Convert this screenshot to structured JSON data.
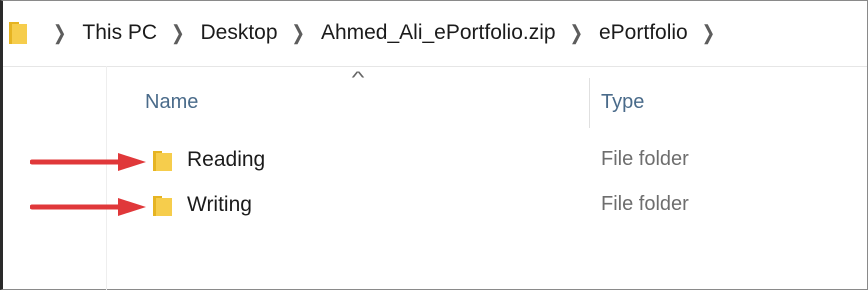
{
  "addressbar": {
    "breadcrumbs": [
      "This PC",
      "Desktop",
      "Ahmed_Ali_ePortfolio.zip",
      "ePortfolio"
    ]
  },
  "columns": {
    "name": "Name",
    "type": "Type"
  },
  "rows": [
    {
      "name": "Reading",
      "type": "File folder",
      "highlighted_by_arrow": true
    },
    {
      "name": "Writing",
      "type": "File folder",
      "highlighted_by_arrow": true
    }
  ],
  "icons": {
    "folder": "folder-icon",
    "chevron": "chevron-right-icon",
    "sort": "sort-ascending-icon",
    "annotation": "red-arrow-icon"
  },
  "colors": {
    "folder": "#f1c232",
    "arrow": "#e0383a",
    "header_text": "#4a6b8a",
    "type_text": "#6e6e6e"
  }
}
